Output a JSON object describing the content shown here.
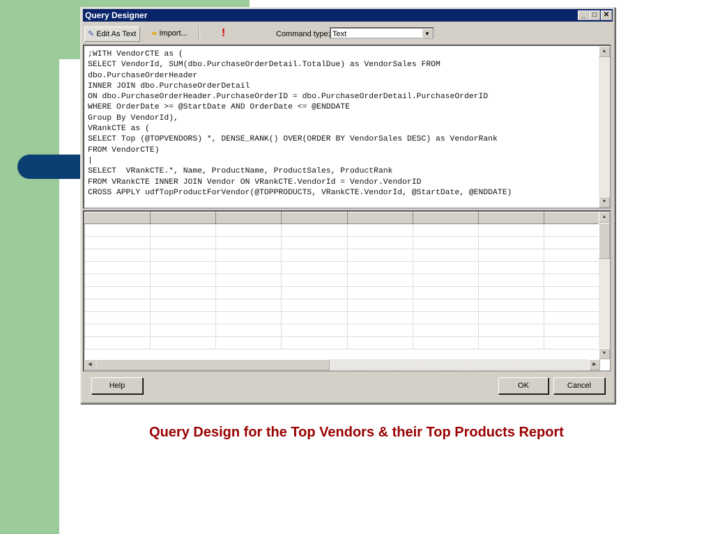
{
  "window": {
    "title": "Query Designer",
    "minimize": "_",
    "maximize": "□",
    "close": "✕"
  },
  "toolbar": {
    "edit_as_text": "Edit As Text",
    "import": "Import...",
    "run": "!",
    "command_type_label": "Command type:",
    "command_type_value": "Text"
  },
  "query_text": ";WITH VendorCTE as (\nSELECT VendorId, SUM(dbo.PurchaseOrderDetail.TotalDue) as VendorSales FROM\ndbo.PurchaseOrderHeader\nINNER JOIN dbo.PurchaseOrderDetail\nON dbo.PurchaseOrderHeader.PurchaseOrderID = dbo.PurchaseOrderDetail.PurchaseOrderID\nWHERE OrderDate >= @StartDate AND OrderDate <= @ENDDATE\nGroup By VendorId),\nVRankCTE as (\nSELECT Top (@TOPVENDORS) *, DENSE_RANK() OVER(ORDER BY VendorSales DESC) as VendorRank\nFROM VendorCTE)\n|\nSELECT  VRankCTE.*, Name, ProductName, ProductSales, ProductRank\nFROM VRankCTE INNER JOIN Vendor ON VRankCTE.VendorId = Vendor.VendorID\nCROSS APPLY udfTopProductForVendor(@TOPPRODUCTS, VRankCTE.VendorId, @StartDate, @ENDDATE)",
  "buttons": {
    "help": "Help",
    "ok": "OK",
    "cancel": "Cancel"
  },
  "caption": "Query Design for the Top Vendors & their Top Products Report"
}
